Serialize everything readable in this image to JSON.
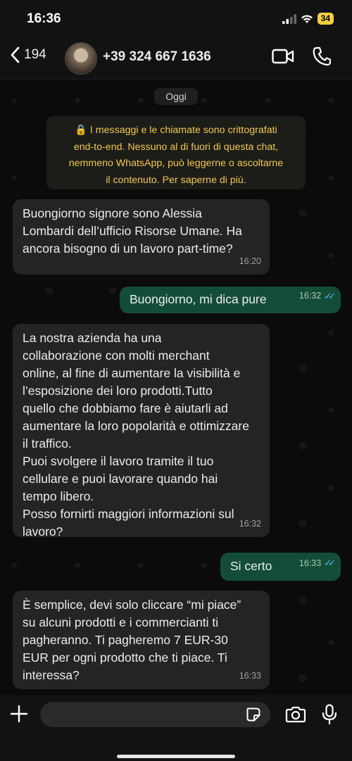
{
  "status_bar": {
    "time": "16:36",
    "battery": "34"
  },
  "header": {
    "back_count": "194",
    "contact_name": "+39 324 667 1636"
  },
  "chat": {
    "date_label": "Oggi",
    "encryption_notice": "🔒 I messaggi e le chiamate sono crittografati\nend-to-end. Nessuno al di fuori di questa chat,\nnemmeno WhatsApp, può leggerne o ascoltarne\nil contenuto.  Per saperne di più.",
    "messages": [
      {
        "direction": "incoming",
        "text": "Buongiorno signore sono Alessia\nLombardi dell’ufficio Risorse Umane. Ha\nancora bisogno di un lavoro part-time?",
        "time": "16:20"
      },
      {
        "direction": "outgoing",
        "text": "Buongiorno, mi dica pure",
        "time": "16:32",
        "status": "read"
      },
      {
        "direction": "incoming",
        "text": "La nostra azienda ha una\ncollaborazione con molti merchant\nonline, al fine di aumentare la visibilità e\nl’esposizione dei loro prodotti.Tutto\nquello che dobbiamo fare è aiutarli ad\naumentare la loro popolarità e ottimizzare\nil traffico.\nPuoi svolgere il lavoro tramite il tuo\ncellulare e puoi lavorare quando hai\ntempo libero.\nPosso fornirti maggiori informazioni sul\nlavoro?",
        "time": "16:32"
      },
      {
        "direction": "outgoing",
        "text": "Si certo",
        "time": "16:33",
        "status": "read"
      },
      {
        "direction": "incoming",
        "text": "È semplice, devi solo cliccare “mi piace”\nsu alcuni prodotti e i commercianti ti\npagheranno. Ti pagheremo 7 EUR-30\nEUR per ogni prodotto che ti piace. Ti\ninteressa?",
        "time": "16:33"
      }
    ]
  },
  "input": {
    "placeholder": ""
  },
  "colors": {
    "incoming_bubble": "#242424",
    "outgoing_bubble": "#144d37",
    "notice_text": "#f2c94c",
    "read_ticks": "#53bdeb"
  },
  "icons": [
    "back-chevron-icon",
    "video-call-icon",
    "phone-call-icon",
    "plus-icon",
    "sticker-icon",
    "camera-icon",
    "mic-icon"
  ]
}
